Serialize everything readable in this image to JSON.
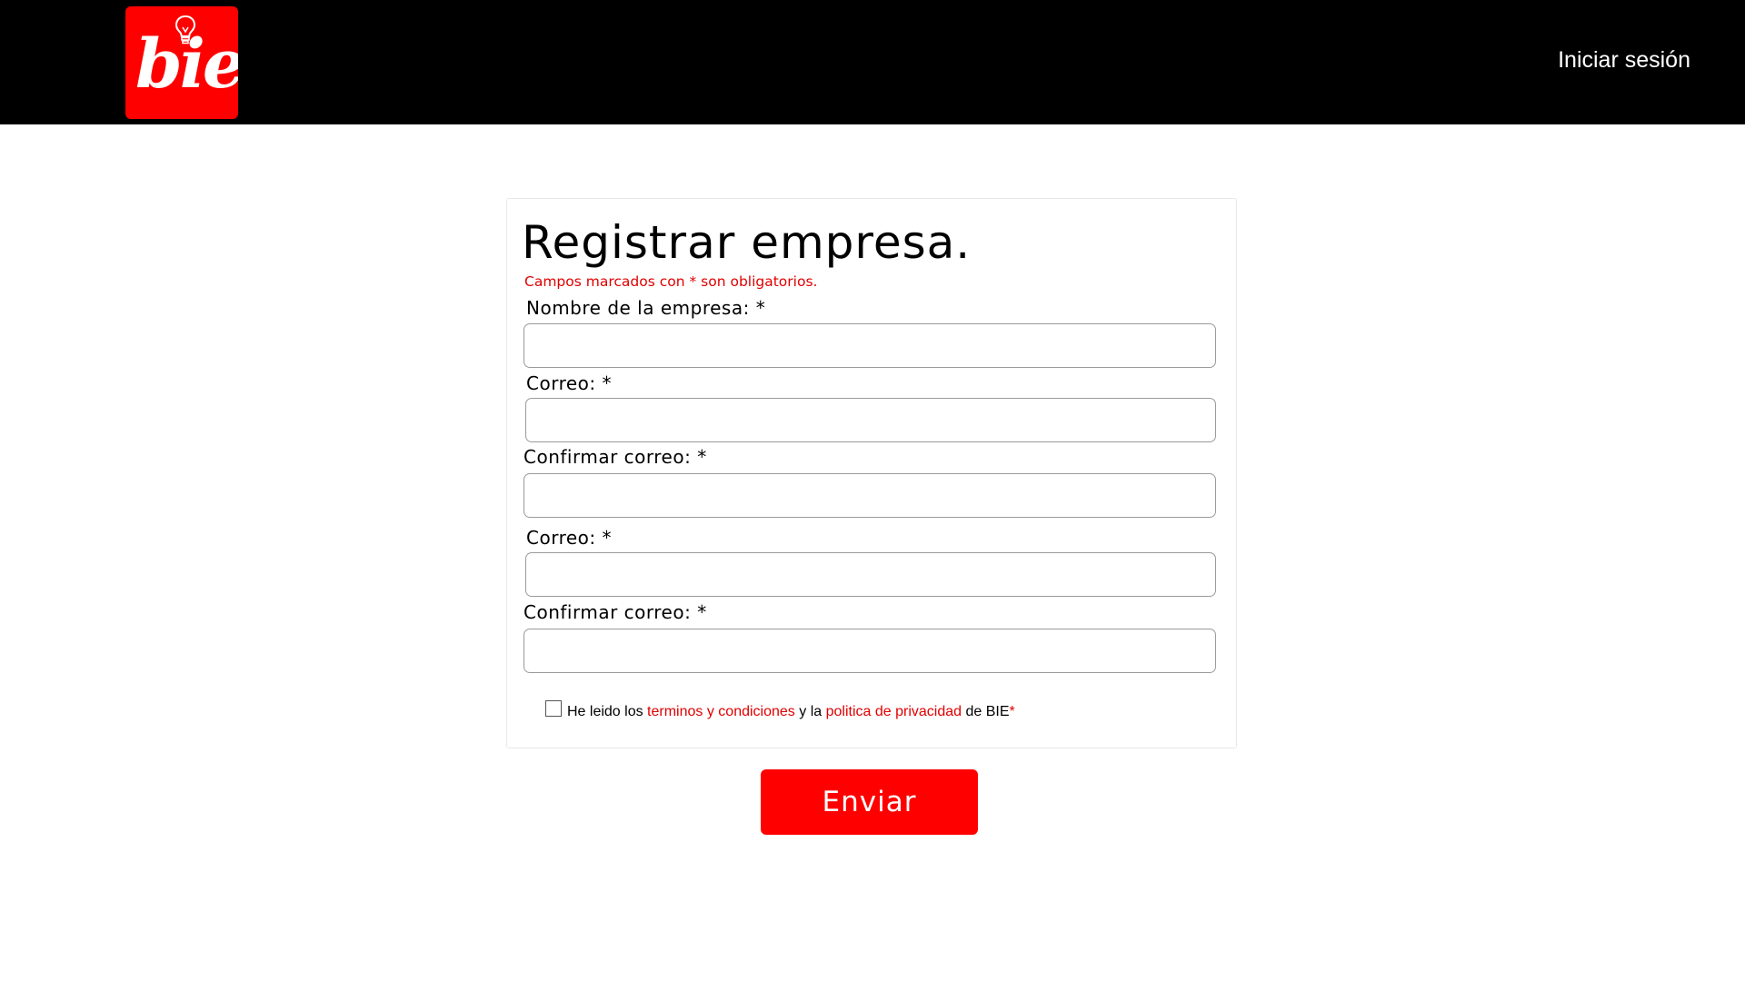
{
  "header": {
    "logo_text": "bie",
    "logo_icon": "lightbulb-icon",
    "login_label": "Iniciar sesión",
    "colors": {
      "bar": "#000000",
      "brand": "#ff0000"
    }
  },
  "form": {
    "title": "Registrar empresa.",
    "required_note": "Campos marcados con * son obligatorios.",
    "fields": [
      {
        "label": "Nombre de la empresa: *",
        "value": ""
      },
      {
        "label": "Correo: *",
        "value": ""
      },
      {
        "label": "Confirmar correo: *",
        "value": ""
      },
      {
        "label": "Correo: *",
        "value": ""
      },
      {
        "label": "Confirmar correo: *",
        "value": ""
      }
    ],
    "terms": {
      "checked": false,
      "prefix": "He leido los ",
      "terms_link": "terminos y condiciones",
      "middle": " y la ",
      "privacy_link": "politica de privacidad",
      "suffix": " de BIE",
      "required_mark": "*"
    },
    "submit_label": "Enviar"
  }
}
